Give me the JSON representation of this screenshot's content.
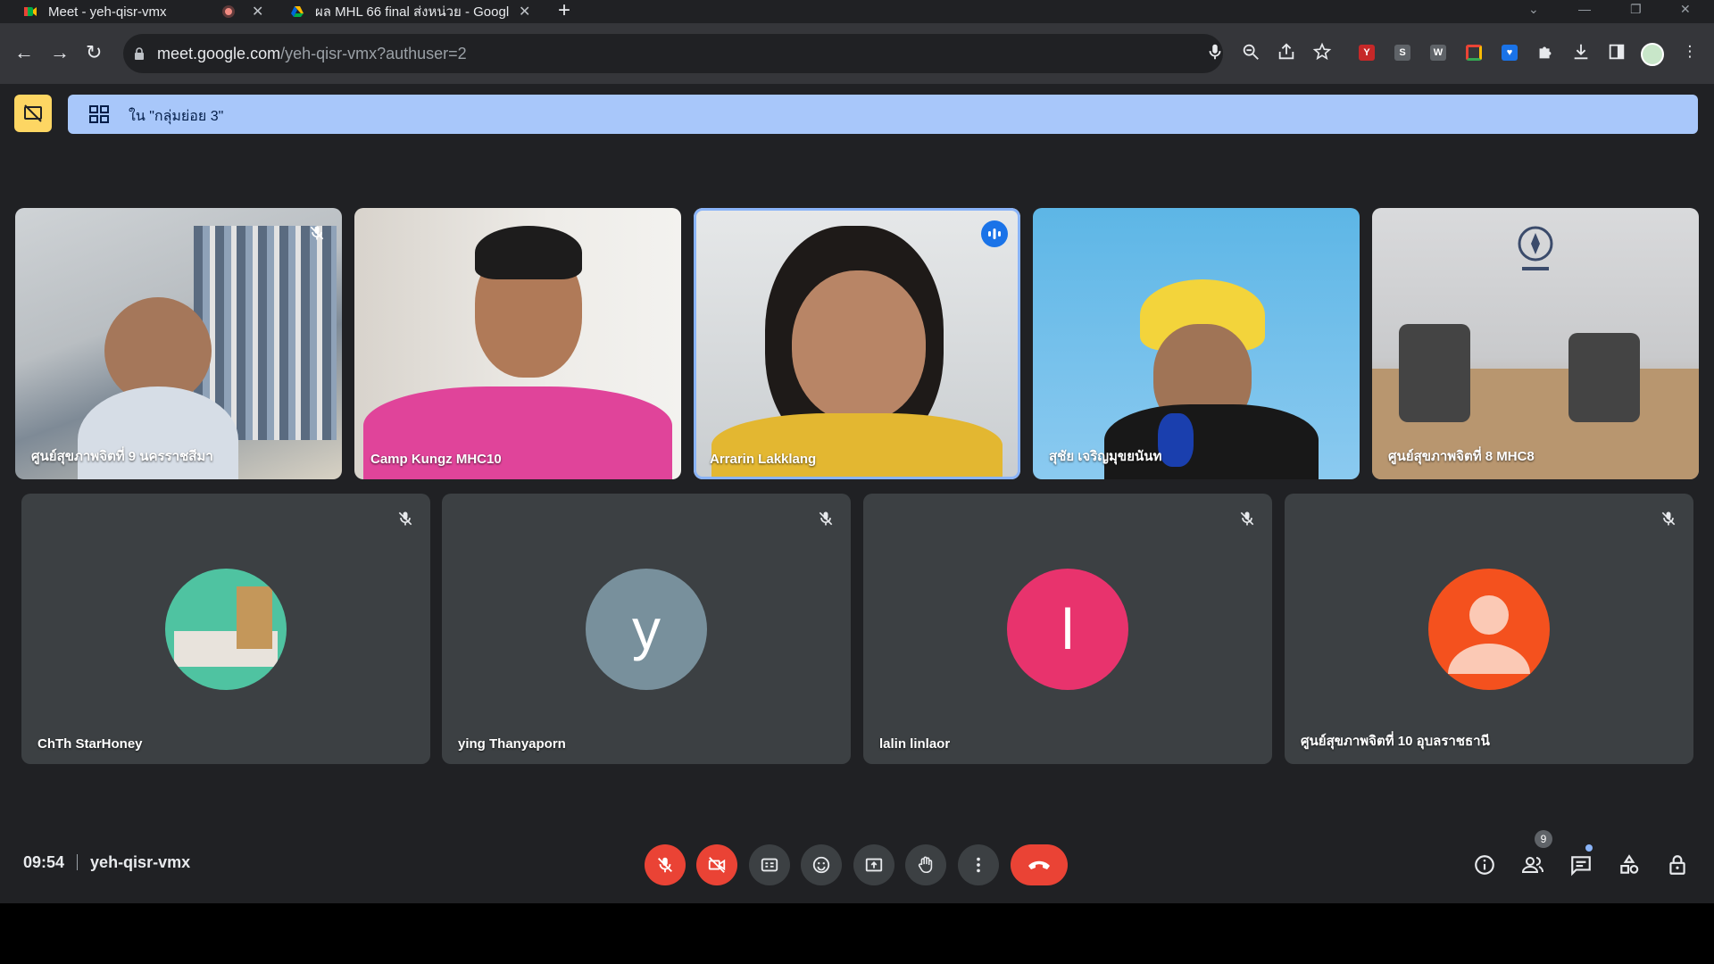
{
  "browser": {
    "tabs": [
      {
        "title": "Meet - yeh-qisr-vmx",
        "active": true
      },
      {
        "title": "ผล MHL 66 final ส่งหน่วย - Googl",
        "active": false
      }
    ],
    "url_host": "meet.google.com",
    "url_path": "/yeh-qisr-vmx?authuser=2"
  },
  "meeting": {
    "breakout_banner": "ใน \"กลุ่มย่อย 3\"",
    "time": "09:54",
    "code": "yeh-qisr-vmx",
    "participant_count": "9"
  },
  "participants_video": [
    {
      "name": "ศูนย์สุขภาพจิตที่ 9 นครราชสีมา",
      "muted": true,
      "speaking": false
    },
    {
      "name": "Camp Kungz MHC10",
      "muted": false,
      "speaking": false
    },
    {
      "name": "Arrarin Lakklang",
      "muted": false,
      "speaking": true
    },
    {
      "name": "สุชัย เจริญมุขยนันท",
      "muted": false,
      "speaking": false
    },
    {
      "name": "ศูนย์สุขภาพจิตที่ 8 MHC8",
      "muted": false,
      "speaking": false
    }
  ],
  "participants_avatar": [
    {
      "name": "ChTh StarHoney",
      "initial": "",
      "color": "#4fc3a1",
      "muted": true
    },
    {
      "name": "ying Thanyaporn",
      "initial": "y",
      "color": "#78909c",
      "muted": true
    },
    {
      "name": "lalin linlaor",
      "initial": "l",
      "color": "#e8336d",
      "muted": true
    },
    {
      "name": "ศูนย์สุขภาพจิตที่ 10 อุบลราชธานี",
      "initial": "",
      "color": "#f4511e",
      "muted": true
    }
  ],
  "icons": [
    "mic-off-icon",
    "camera-off-icon",
    "captions-icon",
    "emoji-icon",
    "present-icon",
    "hand-icon",
    "more-icon",
    "hangup-icon",
    "info-icon",
    "people-icon",
    "chat-icon",
    "activities-icon",
    "host-controls-icon"
  ],
  "colors": {
    "accent": "#8ab4f8",
    "danger": "#ea4335",
    "banner": "#a8c7fa",
    "host": "#fdd663"
  }
}
